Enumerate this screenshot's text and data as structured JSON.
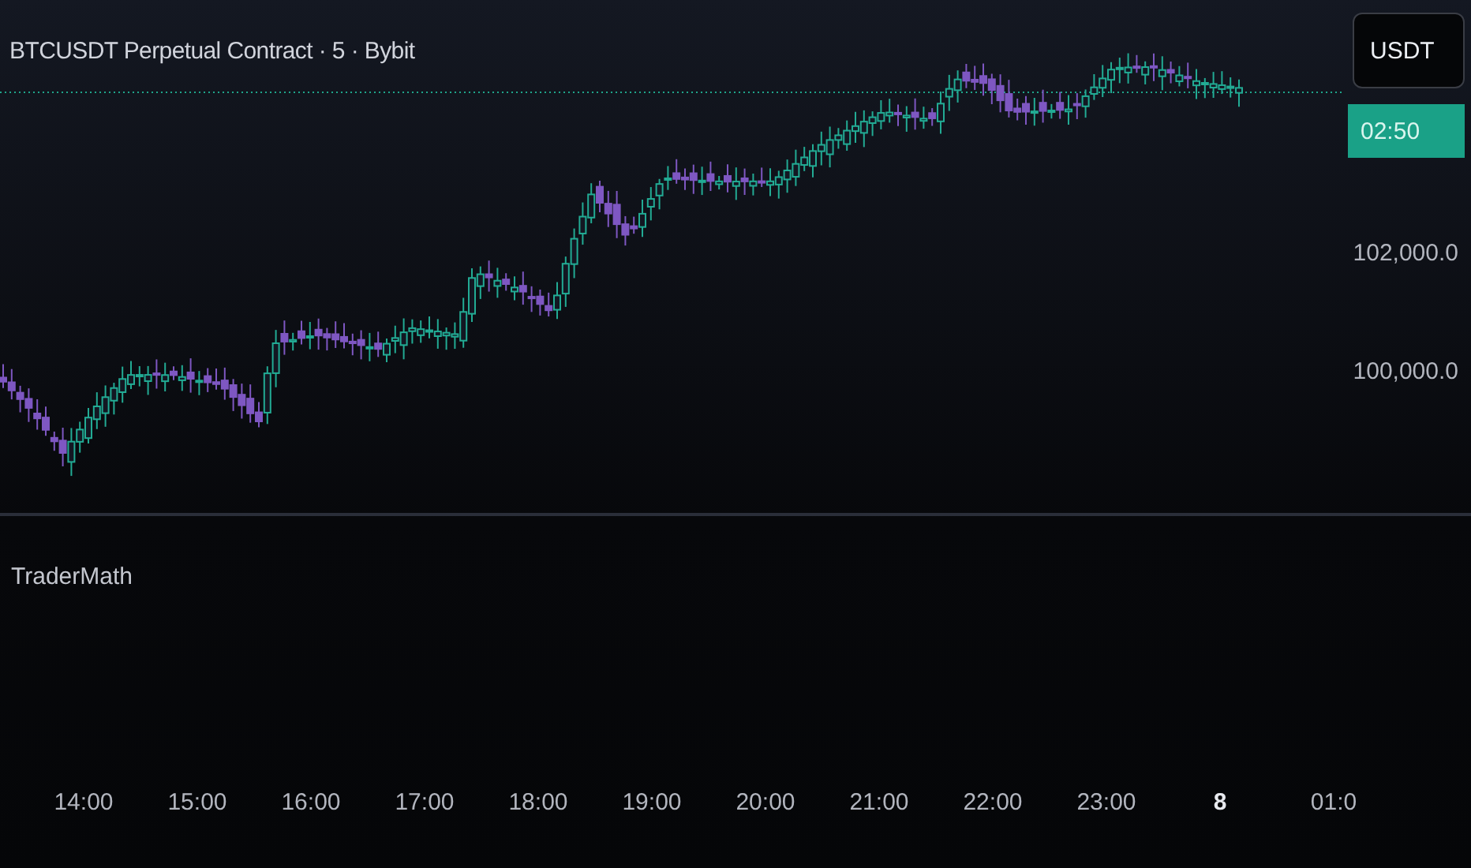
{
  "chart": {
    "title": "BTCUSDT Perpetual Contract · 5 · Bybit"
  },
  "price_axis": {
    "currency": "USDT",
    "countdown": "02:50",
    "labels": [
      "102,000.0",
      "100,000.0"
    ]
  },
  "indicator": {
    "title": "TraderMath"
  },
  "time_axis": [
    {
      "label": "14:00",
      "kind": "time"
    },
    {
      "label": "15:00",
      "kind": "time"
    },
    {
      "label": "16:00",
      "kind": "time"
    },
    {
      "label": "17:00",
      "kind": "time"
    },
    {
      "label": "18:00",
      "kind": "time"
    },
    {
      "label": "19:00",
      "kind": "time"
    },
    {
      "label": "20:00",
      "kind": "time"
    },
    {
      "label": "21:00",
      "kind": "time"
    },
    {
      "label": "22:00",
      "kind": "time"
    },
    {
      "label": "23:00",
      "kind": "time"
    },
    {
      "label": "8",
      "kind": "day"
    },
    {
      "label": "01:0",
      "kind": "time"
    }
  ]
}
